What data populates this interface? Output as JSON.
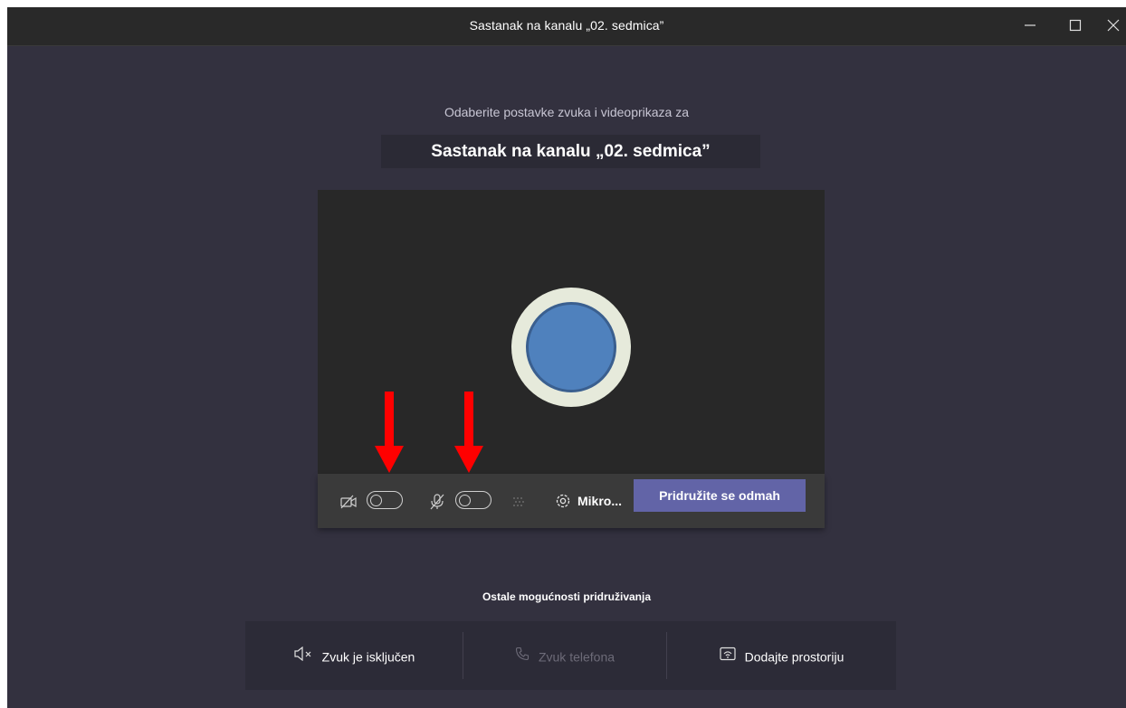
{
  "window": {
    "title": "Sastanak na kanalu „02. sedmica”",
    "controls": [
      "minimize-icon",
      "maximize-icon",
      "close-icon"
    ]
  },
  "prejoin": {
    "subtitle": "Odaberite postavke zvuka i videoprikaza za",
    "meeting_name": "Sastanak na kanalu „02. sedmica”"
  },
  "controls": {
    "camera_toggle_on": false,
    "mic_toggle_on": false,
    "devices_label": "Mikro...",
    "join_label": "Pridružite se odmah"
  },
  "other_options": {
    "title": "Ostale mogućnosti pridruživanja",
    "items": [
      {
        "label": "Zvuk je isključen",
        "icon": "speaker-muted-icon",
        "enabled": true
      },
      {
        "label": "Zvuk telefona",
        "icon": "phone-icon",
        "enabled": false
      },
      {
        "label": "Dodajte prostoriju",
        "icon": "room-cast-icon",
        "enabled": true
      }
    ]
  },
  "colors": {
    "background": "#33313f",
    "titlebar": "#292929",
    "preview": "#282828",
    "controls_bar": "#3a3a3a",
    "accent": "#6264a7",
    "annotation_arrow": "#ff0000",
    "avatar_fill": "#4f81bd",
    "avatar_ring": "#e6eadb"
  }
}
